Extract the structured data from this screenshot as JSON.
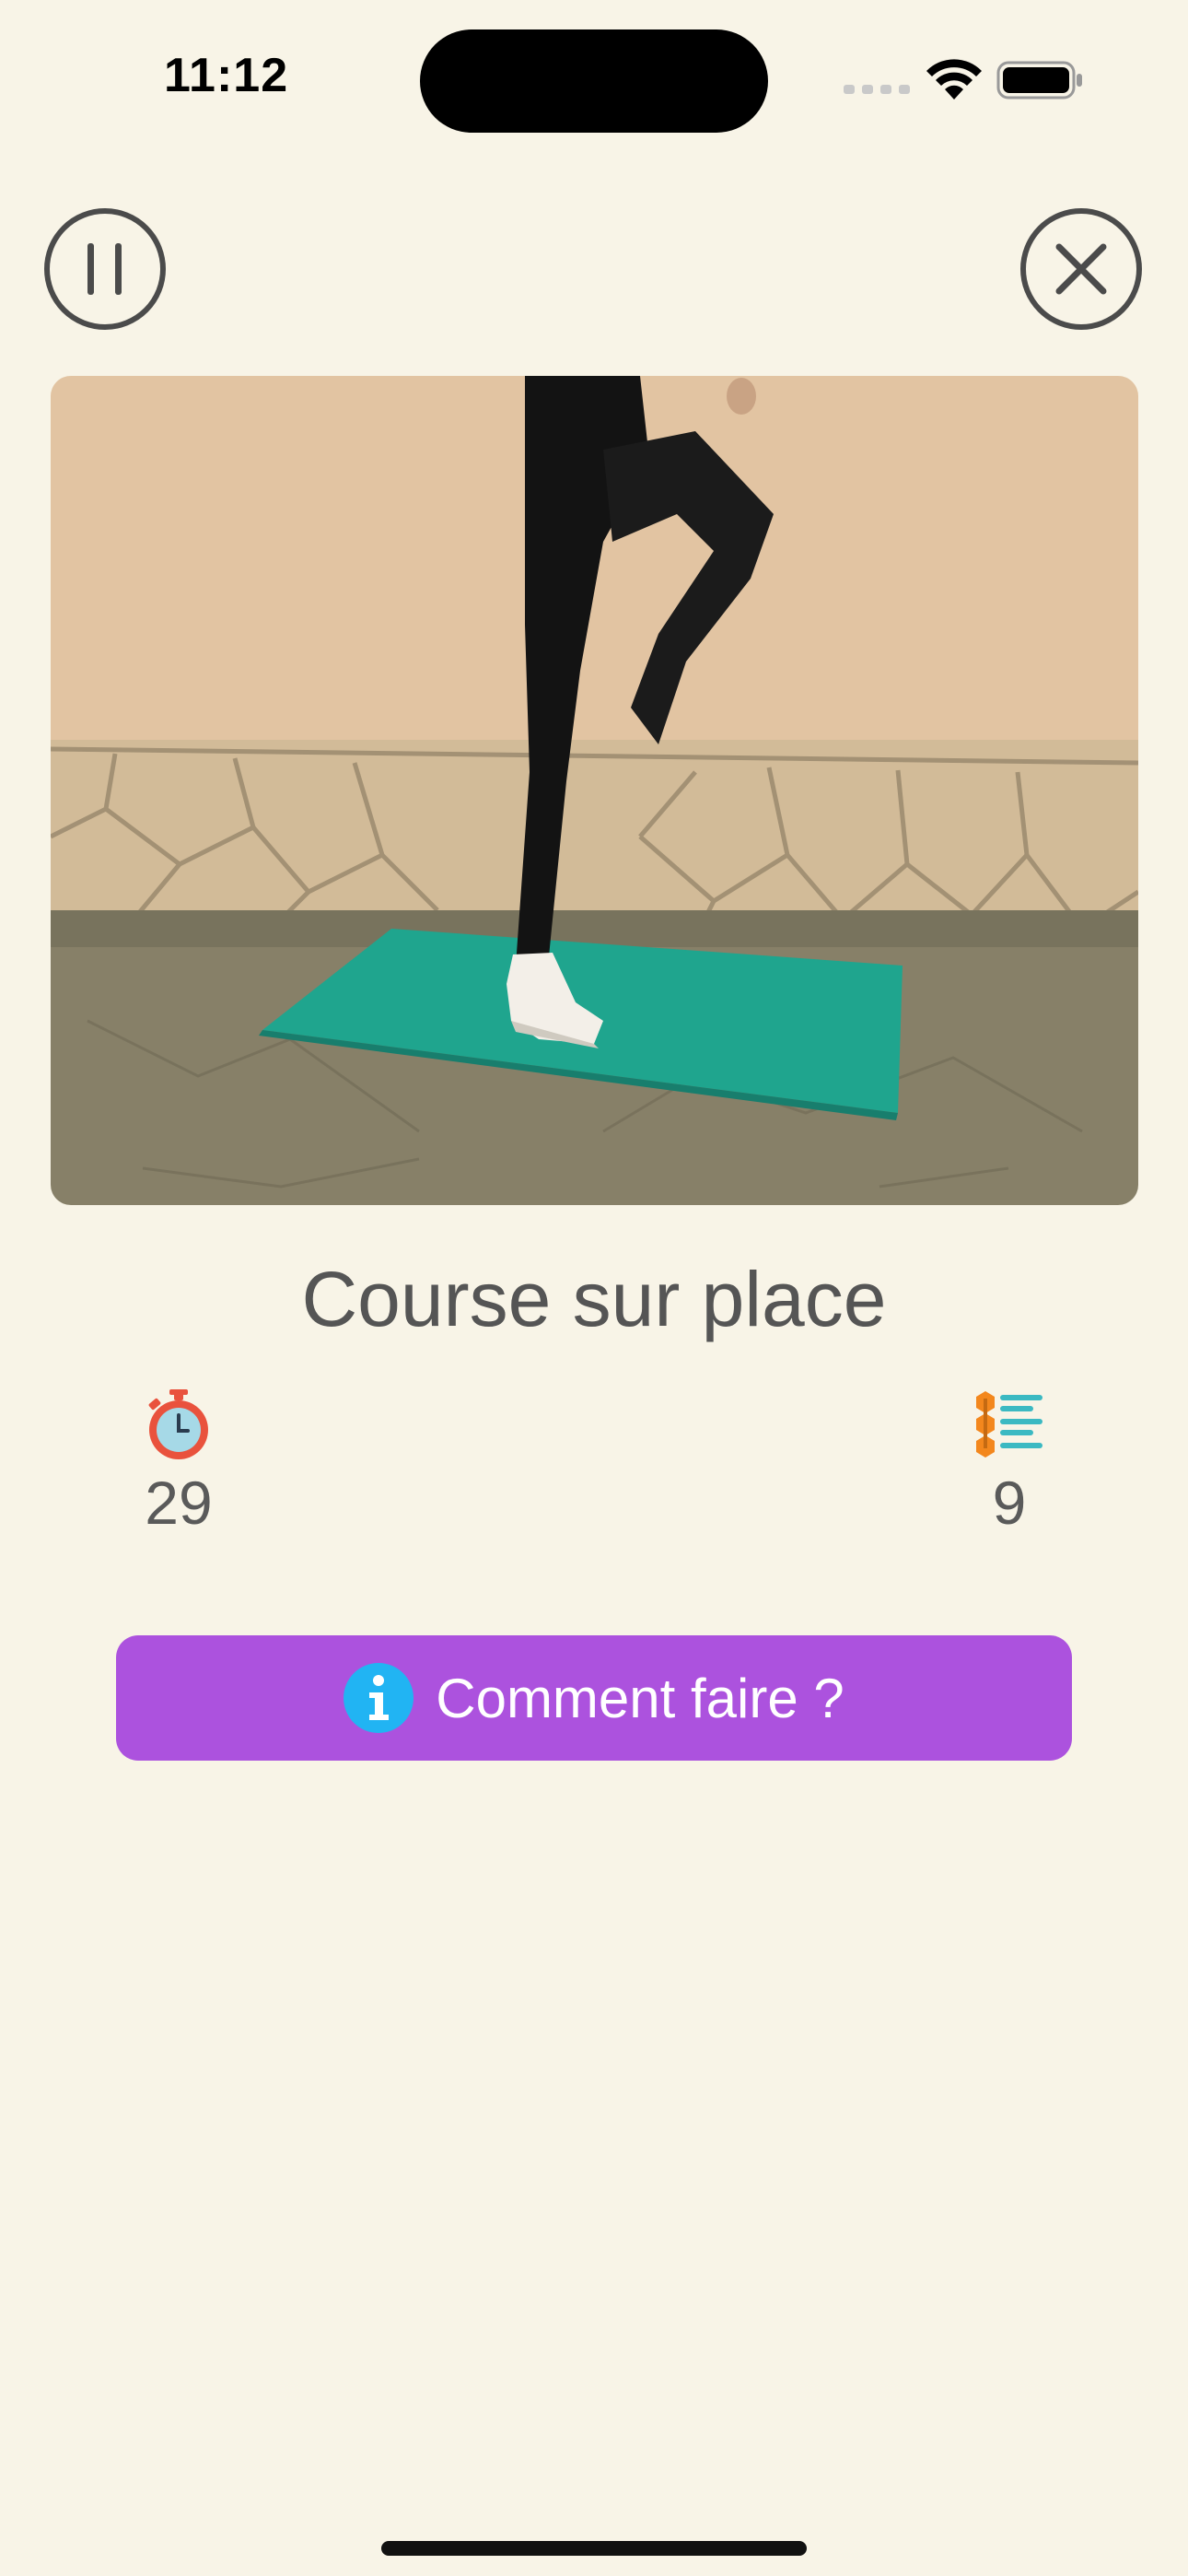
{
  "status_bar": {
    "time": "11:12"
  },
  "controls": {
    "pause_icon": "pause-icon",
    "close_icon": "close-icon"
  },
  "exercise": {
    "title": "Course sur place",
    "duration_icon": "stopwatch-icon",
    "duration_value": "29",
    "reps_icon": "list-icon",
    "reps_value": "9"
  },
  "howto_button": {
    "icon": "info-icon",
    "label": "Comment faire ?"
  },
  "colors": {
    "background": "#f8f4e7",
    "button": "#ac52de",
    "info_icon": "#21b4f3",
    "mat": "#1fa58e"
  }
}
